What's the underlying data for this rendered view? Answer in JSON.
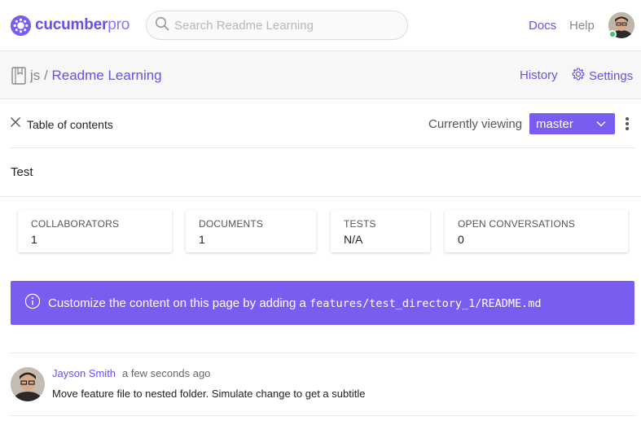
{
  "brand": {
    "name_bold": "cucumber",
    "name_light": "pro",
    "color": "#6b4fe6"
  },
  "search": {
    "placeholder": "Search Readme Learning"
  },
  "nav": {
    "docs": "Docs",
    "help": "Help"
  },
  "repo": {
    "owner": "js",
    "separator": "/",
    "project": "Readme Learning",
    "history": "History",
    "settings": "Settings"
  },
  "toc": {
    "label": "Table of contents",
    "viewing_label": "Currently viewing",
    "branch": "master"
  },
  "page": {
    "title": "Test"
  },
  "stats": [
    {
      "key": "COLLABORATORS",
      "value": "1"
    },
    {
      "key": "DOCUMENTS",
      "value": "1"
    },
    {
      "key": "TESTS",
      "value": "N/A"
    },
    {
      "key": "OPEN CONVERSATIONS",
      "value": "0"
    }
  ],
  "banner": {
    "text": "Customize the content on this page by adding a",
    "path": "features/test_directory_1/README.md",
    "color": "#7b5cf0"
  },
  "commit": {
    "author": "Jayson Smith",
    "time": "a few seconds ago",
    "message": "Move feature file to nested folder. Simulate change to get a subtitle"
  },
  "colors": {
    "accent": "#7b5cf0",
    "online": "#3ac46c"
  }
}
